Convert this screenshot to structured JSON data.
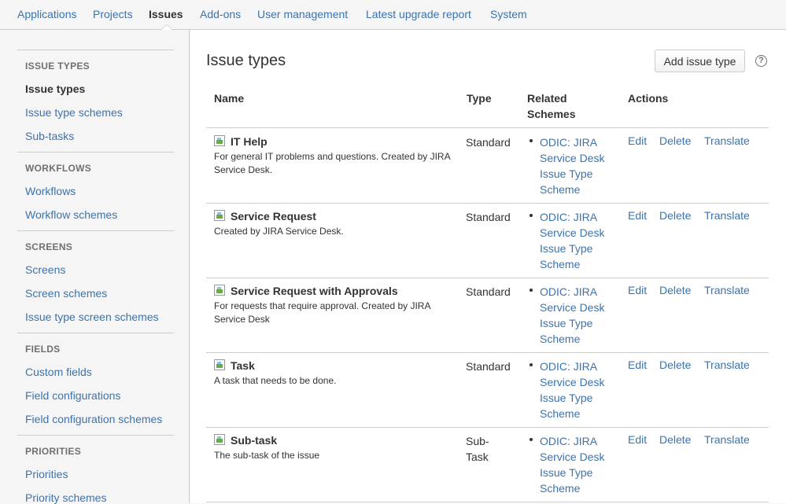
{
  "topnav": {
    "tabs": [
      "Applications",
      "Projects",
      "Issues",
      "Add-ons",
      "User management",
      "Latest upgrade report",
      "System"
    ],
    "active": "Issues"
  },
  "sidebar": {
    "groups": [
      {
        "heading": "ISSUE TYPES",
        "items": [
          "Issue types",
          "Issue type schemes",
          "Sub-tasks"
        ]
      },
      {
        "heading": "WORKFLOWS",
        "items": [
          "Workflows",
          "Workflow schemes"
        ]
      },
      {
        "heading": "SCREENS",
        "items": [
          "Screens",
          "Screen schemes",
          "Issue type screen schemes"
        ]
      },
      {
        "heading": "FIELDS",
        "items": [
          "Custom fields",
          "Field configurations",
          "Field configuration schemes"
        ]
      },
      {
        "heading": "PRIORITIES",
        "items": [
          "Priorities",
          "Priority schemes"
        ]
      }
    ],
    "active_item": "Issue types"
  },
  "main": {
    "title": "Issue types",
    "add_button": "Add issue type",
    "help": "?",
    "columns": {
      "name": "Name",
      "type": "Type",
      "related": "Related Schemes",
      "actions": "Actions"
    },
    "rows": [
      {
        "name": "IT Help",
        "desc": "For general IT problems and questions. Created by JIRA Service Desk.",
        "type": "Standard",
        "scheme": "ODIC: JIRA Service Desk Issue Type Scheme"
      },
      {
        "name": "Service Request",
        "desc": "Created by JIRA Service Desk.",
        "type": "Standard",
        "scheme": "ODIC: JIRA Service Desk Issue Type Scheme"
      },
      {
        "name": "Service Request with Approvals",
        "desc": "For requests that require approval. Created by JIRA Service Desk",
        "type": "Standard",
        "scheme": "ODIC: JIRA Service Desk Issue Type Scheme"
      },
      {
        "name": "Task",
        "desc": "A task that needs to be done.",
        "type": "Standard",
        "scheme": "ODIC: JIRA Service Desk Issue Type Scheme"
      },
      {
        "name": "Sub-task",
        "desc": "The sub-task of the issue",
        "type": "Sub-Task",
        "scheme": "ODIC: JIRA Service Desk Issue Type Scheme"
      }
    ],
    "actions": {
      "edit": "Edit",
      "delete": "Delete",
      "translate": "Translate"
    }
  }
}
